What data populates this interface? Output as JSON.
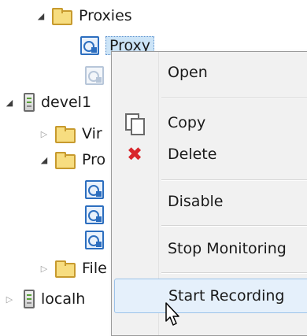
{
  "tree": {
    "proxies_label": "Proxies",
    "proxy_selected_label": "Proxy",
    "devel_label": "devel1",
    "vir_label": "Vir",
    "pro_label": "Pro",
    "file_label": "File",
    "localhost_label": "localh"
  },
  "context_menu": {
    "open": "Open",
    "copy": "Copy",
    "delete": "Delete",
    "disable": "Disable",
    "stop_monitoring": "Stop Monitoring",
    "start_recording": "Start Recording"
  },
  "colors": {
    "folder": "#f7dd80",
    "selection": "#cce4f7",
    "delete": "#d8262b",
    "menu_bg": "#f1f1f1"
  },
  "icons": [
    "folder-icon",
    "server-icon",
    "proxy-icon",
    "copy-icon",
    "delete-icon",
    "pointer-cursor-icon"
  ]
}
